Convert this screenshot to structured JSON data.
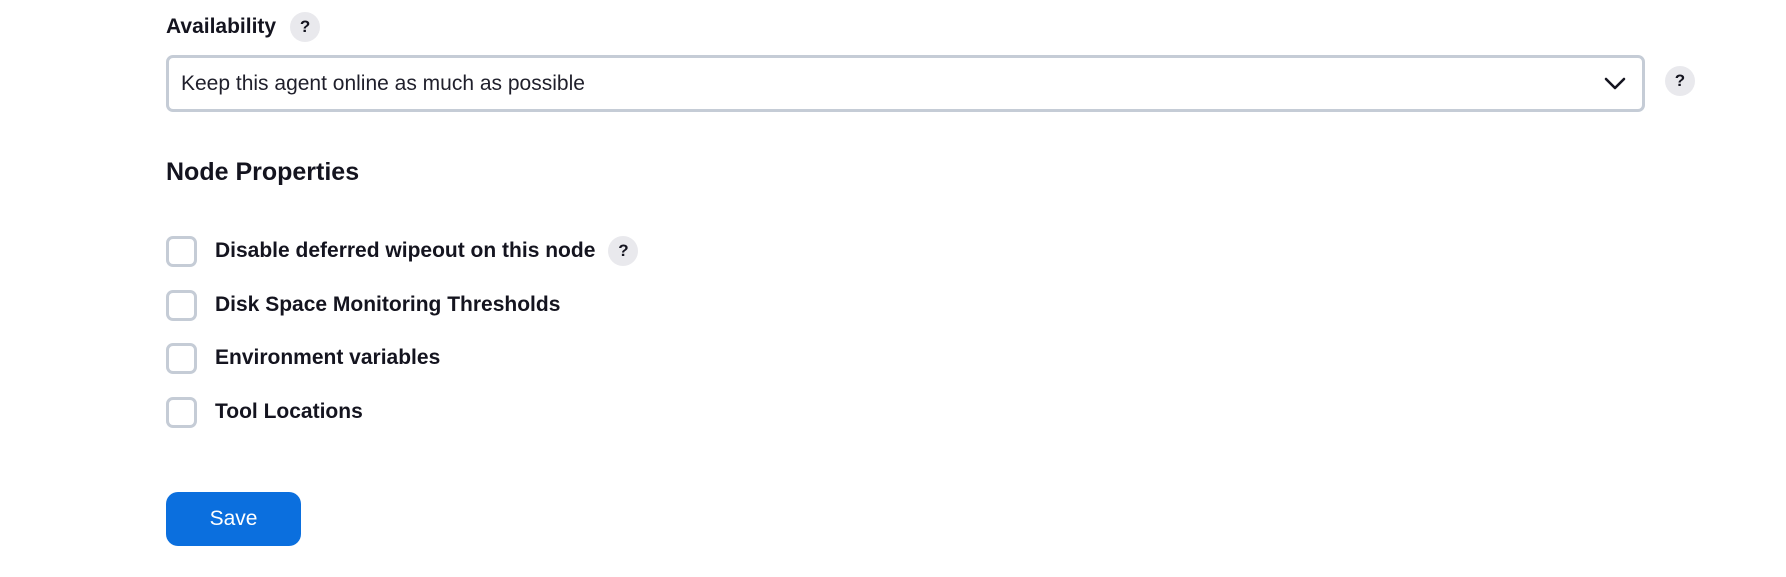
{
  "availability": {
    "label": "Availability",
    "help_icon": "?",
    "selected_value": "Keep this agent online as much as possible",
    "dropdown_icon": "chevron-down-icon",
    "select_help_icon": "?"
  },
  "node_properties": {
    "heading": "Node Properties",
    "items": [
      {
        "label": "Disable deferred wipeout on this node",
        "checked": false,
        "help_icon": "?"
      },
      {
        "label": "Disk Space Monitoring Thresholds",
        "checked": false
      },
      {
        "label": "Environment variables",
        "checked": false
      },
      {
        "label": "Tool Locations",
        "checked": false
      }
    ]
  },
  "actions": {
    "save_label": "Save"
  },
  "colors": {
    "accent": "#0b6fde",
    "border": "#c5ccd6",
    "help_bg": "#e9e9ed",
    "text": "#14141f"
  }
}
